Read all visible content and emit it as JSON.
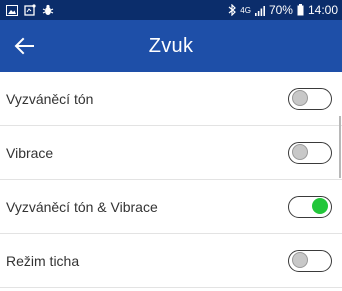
{
  "status_bar": {
    "network": "4G",
    "battery": "70%",
    "time": "14:00",
    "icons_left": [
      "image-icon",
      "app-notification-icon",
      "bug-icon"
    ],
    "icons_right": [
      "bluetooth-icon",
      "signal-icon",
      "battery-icon"
    ]
  },
  "app_bar": {
    "title": "Zvuk",
    "back_icon": "arrow-left-icon",
    "color": "#1e4fa8"
  },
  "settings": [
    {
      "label": "Vyzváněcí tón",
      "enabled": false
    },
    {
      "label": "Vibrace",
      "enabled": false
    },
    {
      "label": "Vyzváněcí tón & Vibrace",
      "enabled": true
    },
    {
      "label": "Režim ticha",
      "enabled": false
    }
  ],
  "colors": {
    "status_bar": "#0b2d6b",
    "toggle_on": "#22c63a",
    "toggle_off": "#c8c8c8"
  }
}
